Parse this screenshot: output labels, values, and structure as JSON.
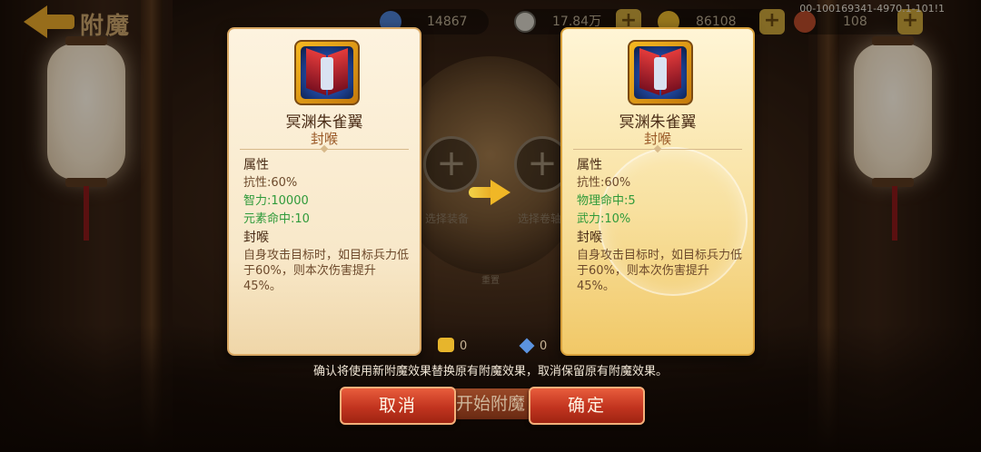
{
  "header": {
    "title": "附魔",
    "version": "00-100169341-4970.1-101!1",
    "resources": [
      {
        "icon": "crystal-icon",
        "value": "14867"
      },
      {
        "icon": "coin-icon",
        "value": "17.84万"
      },
      {
        "icon": "gold-ingot-icon",
        "value": "86108"
      },
      {
        "icon": "meat-icon",
        "value": "108"
      }
    ]
  },
  "background": {
    "slot_left_label": "选择装备",
    "slot_right_label": "选择卷轴",
    "reset_label": "重置",
    "start_label": "开始附魔",
    "cost_ingot": "0",
    "cost_gem": "0"
  },
  "cards": {
    "left": {
      "item_name": "冥渊朱雀翼",
      "enchant_name": "封喉",
      "attr_header": "属性",
      "attrs": [
        "抗性:60%",
        "智力:10000",
        "元素命中:10"
      ],
      "skill_header": "封喉",
      "skill_desc": "自身攻击目标时，如目标兵力低于60%，则本次伤害提升45%。"
    },
    "right": {
      "item_name": "冥渊朱雀翼",
      "enchant_name": "封喉",
      "attr_header": "属性",
      "attrs": [
        "抗性:60%",
        "物理命中:5",
        "武力:10%"
      ],
      "skill_header": "封喉",
      "skill_desc": "自身攻击目标时，如目标兵力低于60%，则本次伤害提升45%。"
    }
  },
  "dialog": {
    "message": "确认将使用新附魔效果替换原有附魔效果，取消保留原有附魔效果。",
    "cancel_label": "取消",
    "confirm_label": "确定"
  },
  "colors": {
    "attr_green": "#2f9a3a",
    "button_red": "#c2341f",
    "accent_gold": "#e8a82a"
  }
}
